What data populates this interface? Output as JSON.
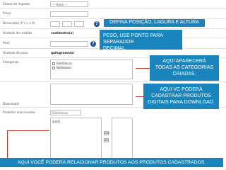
{
  "rows": {
    "tax_class": {
      "label": "Classe de imposto",
      "value": "--- Nada ---"
    },
    "price": {
      "label": "Preço"
    },
    "dimensions": {
      "label": "Dimensões (P x L x A)"
    },
    "length_unit": {
      "label": "Unidade de medida",
      "value": "centímetro(s)"
    },
    "weight": {
      "label": "Peso"
    },
    "weight_unit": {
      "label": "Unidade de peso",
      "value": "quilograma(s)"
    },
    "categories": {
      "label": "Categorias",
      "items": [
        "Eletrônicos",
        "Notebooks"
      ]
    },
    "downloads": {
      "label": "Downloads"
    },
    "related": {
      "label": "Produtos relacionados",
      "select_value": "Eletrônicos",
      "list_items": [
        "ipad2"
      ],
      "add_label": "add",
      "remove_label": "del"
    }
  },
  "callouts": {
    "dimensions": "DEFINA POSIÇÃO, LAGURA E ALTURA",
    "weight": [
      "PESO, USE PONTO PARA SEPARADOR",
      "DECIMAL."
    ],
    "categories": [
      "AQUI APARECERÁ",
      "TODAS AS CATEGORIAS",
      "CRIADAS."
    ],
    "downloads": [
      "AQUI VC PODERÁ",
      "CADASTRAR PRODUTOS",
      "DIGITAIS PARA DOWNLOAD."
    ],
    "related": "AQUI VOCÊ PODERÁ RELACIONAR PRODUTOS AOS PRODUTOS CADASTRADOS."
  },
  "icons": {
    "help": "question-icon"
  },
  "colors": {
    "callout": "#1a84bd",
    "help": "#1e4ea8",
    "arrow": "#c0392b"
  }
}
